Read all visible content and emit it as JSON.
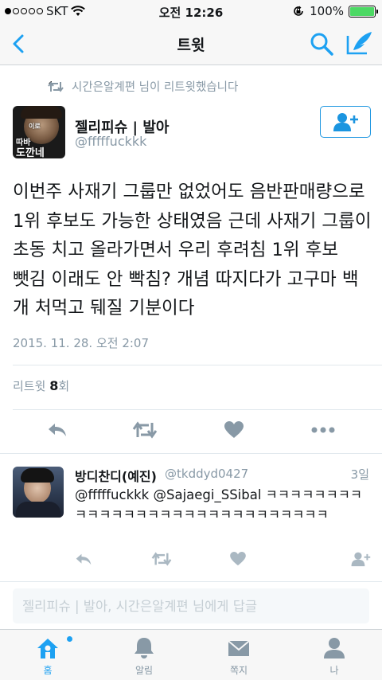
{
  "status_bar": {
    "carrier": "SKT",
    "time": "오전 12:26",
    "battery": "100%"
  },
  "nav": {
    "title": "트윗",
    "back_icon": "chevron-left-icon",
    "search_icon": "search-icon",
    "compose_icon": "compose-icon"
  },
  "retweet_context": {
    "text": "시간은알계편 님이 리트윗했습니다"
  },
  "tweet": {
    "display_name": "젤리피슈 | 발아",
    "handle": "@fffffuckkk",
    "avatar_caption_line1": "이로",
    "avatar_caption_line2": "따바",
    "avatar_caption_line3": "도깐네",
    "text": "이번주 사재기 그룹만 없었어도 음반판매량으로 1위 후보도 가능한 상태였음 근데 사재기 그룹이 초동 치고 올라가면서 우리 후려침 1위 후보 뺏김 이래도 안 빡침? 개념 따지다가 고구마 백 개 처먹고 뒈질 기분이다",
    "timestamp": "2015. 11. 28. 오전 2:07",
    "retweet_label": "리트윗",
    "retweet_count": "8",
    "retweet_unit": "회"
  },
  "reply": {
    "display_name": "방디찬디(예진)",
    "handle": "@tkddyd0427",
    "time": "3일",
    "text": "@fffffuckkk @Sajaegi_SSibal ㅋㅋㅋㅋㅋㅋㅋㅋㅋㅋㅋㅋㅋㅋㅋㅋㅋㅋㅋㅋㅋㅋㅋㅋㅋㅋㅋㅋㅋ"
  },
  "compose": {
    "placeholder": "젤리피슈 | 발아, 시간은알계편 님에게 답글"
  },
  "tab_bar": {
    "tabs": [
      {
        "label": "홈",
        "icon": "home-icon",
        "active": true
      },
      {
        "label": "알림",
        "icon": "bell-icon",
        "active": false
      },
      {
        "label": "쪽지",
        "icon": "envelope-icon",
        "active": false
      },
      {
        "label": "나",
        "icon": "person-icon",
        "active": false
      }
    ]
  },
  "colors": {
    "accent": "#1da1f2",
    "muted": "#8899a6",
    "like": "#8899a6",
    "battery": "#4cd964"
  }
}
